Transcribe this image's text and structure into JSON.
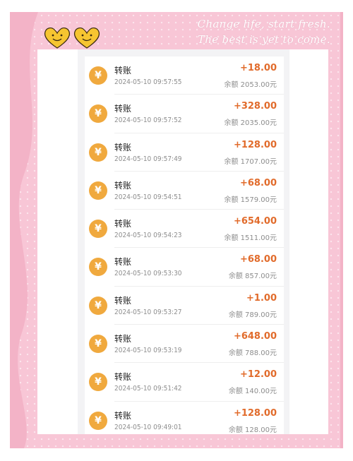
{
  "decoration": {
    "tagline_line1": "Change life, start fresh.",
    "tagline_line2": "The best is yet to come."
  },
  "transactions": [
    {
      "icon": "yuan-coin-icon",
      "symbol": "¥",
      "title": "转账",
      "time": "2024-05-10 09:57:55",
      "amount": "+18.00",
      "balance": "余额 2053.00元"
    },
    {
      "icon": "yuan-coin-icon",
      "symbol": "¥",
      "title": "转账",
      "time": "2024-05-10 09:57:52",
      "amount": "+328.00",
      "balance": "余额 2035.00元"
    },
    {
      "icon": "yuan-coin-icon",
      "symbol": "¥",
      "title": "转账",
      "time": "2024-05-10 09:57:49",
      "amount": "+128.00",
      "balance": "余额 1707.00元"
    },
    {
      "icon": "yuan-coin-icon",
      "symbol": "¥",
      "title": "转账",
      "time": "2024-05-10 09:54:51",
      "amount": "+68.00",
      "balance": "余额 1579.00元"
    },
    {
      "icon": "yuan-coin-icon",
      "symbol": "¥",
      "title": "转账",
      "time": "2024-05-10 09:54:23",
      "amount": "+654.00",
      "balance": "余额 1511.00元"
    },
    {
      "icon": "yuan-coin-icon",
      "symbol": "¥",
      "title": "转账",
      "time": "2024-05-10 09:53:30",
      "amount": "+68.00",
      "balance": "余额 857.00元"
    },
    {
      "icon": "yuan-coin-icon",
      "symbol": "¥",
      "title": "转账",
      "time": "2024-05-10 09:53:27",
      "amount": "+1.00",
      "balance": "余额 789.00元"
    },
    {
      "icon": "yuan-coin-icon",
      "symbol": "¥",
      "title": "转账",
      "time": "2024-05-10 09:53:19",
      "amount": "+648.00",
      "balance": "余额 788.00元"
    },
    {
      "icon": "yuan-coin-icon",
      "symbol": "¥",
      "title": "转账",
      "time": "2024-05-10 09:51:42",
      "amount": "+12.00",
      "balance": "余额 140.00元"
    },
    {
      "icon": "yuan-coin-icon",
      "symbol": "¥",
      "title": "转账",
      "time": "2024-05-10 09:49:01",
      "amount": "+128.00",
      "balance": "余额 128.00元"
    }
  ],
  "colors": {
    "frame_pink": "#f8c6d6",
    "coin_orange": "#f0a93e",
    "amount_orange": "#e16b2b",
    "heart_yellow": "#f6c531"
  }
}
